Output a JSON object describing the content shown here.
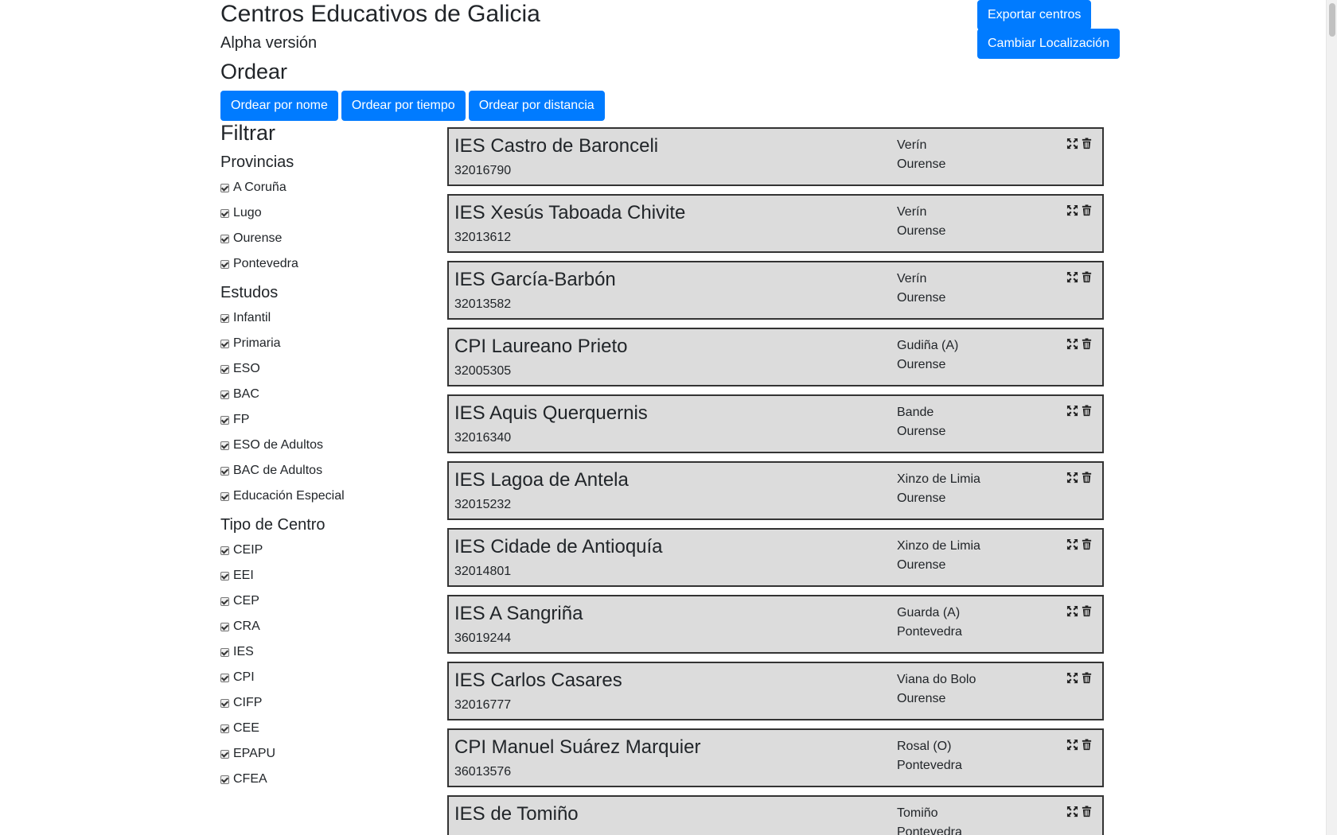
{
  "header": {
    "title": "Centros Educativos de Galicia",
    "subtitle": "Alpha versión",
    "order_heading": "Ordear"
  },
  "actions": {
    "export_label": "Exportar centros",
    "change_location_label": "Cambiar Localización"
  },
  "order_buttons": [
    {
      "label": "Ordear por nome"
    },
    {
      "label": "Ordear por tiempo"
    },
    {
      "label": "Ordear por distancia"
    }
  ],
  "filters": {
    "heading": "Filtrar",
    "groups": [
      {
        "title": "Provincias",
        "options": [
          {
            "label": "A Coruña",
            "checked": true
          },
          {
            "label": "Lugo",
            "checked": true
          },
          {
            "label": "Ourense",
            "checked": true
          },
          {
            "label": "Pontevedra",
            "checked": true
          }
        ]
      },
      {
        "title": "Estudos",
        "options": [
          {
            "label": "Infantil",
            "checked": true
          },
          {
            "label": "Primaria",
            "checked": true
          },
          {
            "label": "ESO",
            "checked": true
          },
          {
            "label": "BAC",
            "checked": true
          },
          {
            "label": "FP",
            "checked": true
          },
          {
            "label": "ESO de Adultos",
            "checked": true
          },
          {
            "label": "BAC de Adultos",
            "checked": true
          },
          {
            "label": "Educación Especial",
            "checked": true
          }
        ]
      },
      {
        "title": "Tipo de Centro",
        "options": [
          {
            "label": "CEIP",
            "checked": true
          },
          {
            "label": "EEI",
            "checked": true
          },
          {
            "label": "CEP",
            "checked": true
          },
          {
            "label": "CRA",
            "checked": true
          },
          {
            "label": "IES",
            "checked": true
          },
          {
            "label": "CPI",
            "checked": true
          },
          {
            "label": "CIFP",
            "checked": true
          },
          {
            "label": "CEE",
            "checked": true
          },
          {
            "label": "EPAPU",
            "checked": true
          },
          {
            "label": "CFEA",
            "checked": true
          }
        ]
      }
    ]
  },
  "centers": [
    {
      "name": "IES Castro de Baronceli",
      "code": "32016790",
      "city": "Verín",
      "province": "Ourense"
    },
    {
      "name": "IES Xesús Taboada Chivite",
      "code": "32013612",
      "city": "Verín",
      "province": "Ourense"
    },
    {
      "name": "IES García-Barbón",
      "code": "32013582",
      "city": "Verín",
      "province": "Ourense"
    },
    {
      "name": "CPI Laureano Prieto",
      "code": "32005305",
      "city": "Gudiña (A)",
      "province": "Ourense"
    },
    {
      "name": "IES Aquis Querquernis",
      "code": "32016340",
      "city": "Bande",
      "province": "Ourense"
    },
    {
      "name": "IES Lagoa de Antela",
      "code": "32015232",
      "city": "Xinzo de Limia",
      "province": "Ourense"
    },
    {
      "name": "IES Cidade de Antioquía",
      "code": "32014801",
      "city": "Xinzo de Limia",
      "province": "Ourense"
    },
    {
      "name": "IES A Sangriña",
      "code": "36019244",
      "city": "Guarda (A)",
      "province": "Pontevedra"
    },
    {
      "name": "IES Carlos Casares",
      "code": "32016777",
      "city": "Viana do Bolo",
      "province": "Ourense"
    },
    {
      "name": "CPI Manuel Suárez Marquier",
      "code": "36013576",
      "city": "Rosal (O)",
      "province": "Pontevedra"
    },
    {
      "name": "IES de Tomiño",
      "code": "",
      "city": "Tomiño",
      "province": "Pontevedra"
    }
  ],
  "icons": {
    "expand": "expand-arrows-icon",
    "delete": "trash-icon"
  },
  "colors": {
    "primary": "#007bff",
    "card_bg": "#dcdcdc",
    "card_border": "#333333"
  }
}
